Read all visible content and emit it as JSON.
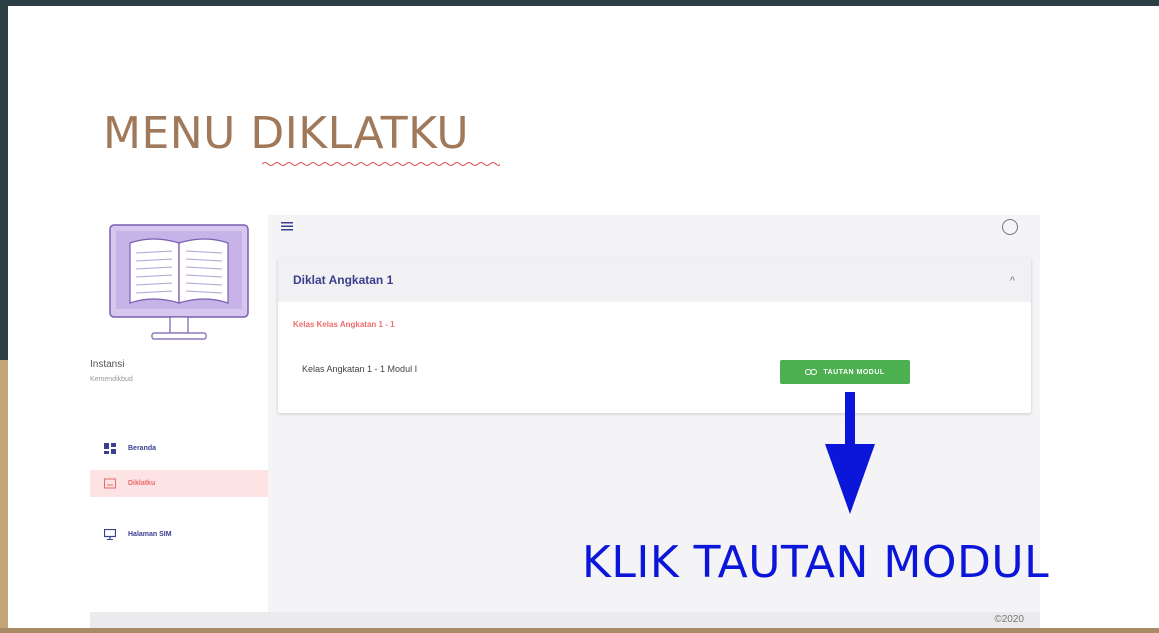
{
  "slide": {
    "title_plain": "MENU ",
    "title_underlined": "DIKLATKU",
    "annotation": "KLIK TAUTAN MODUL"
  },
  "app": {
    "profile": {
      "label": "Instansi",
      "value": "Kemendikbud"
    },
    "nav": [
      {
        "label": "Beranda",
        "icon": "dashboard-icon"
      },
      {
        "label": "Diklatku",
        "icon": "class-icon",
        "active": true
      },
      {
        "label": "Halaman SIM",
        "icon": "monitor-icon"
      }
    ],
    "card": {
      "title": "Diklat Angkatan 1",
      "class_title": "Kelas Kelas Angkatan 1 - 1",
      "module": "Kelas Angkatan 1 - 1 Modul I",
      "button": "TAUTAN MODUL"
    },
    "footer": "©2020"
  },
  "colors": {
    "title": "#a0785a",
    "annotation": "#0b16d9",
    "button": "#4caf50",
    "active_nav_bg": "#fde3e3",
    "class_title": "#f06c6c"
  }
}
